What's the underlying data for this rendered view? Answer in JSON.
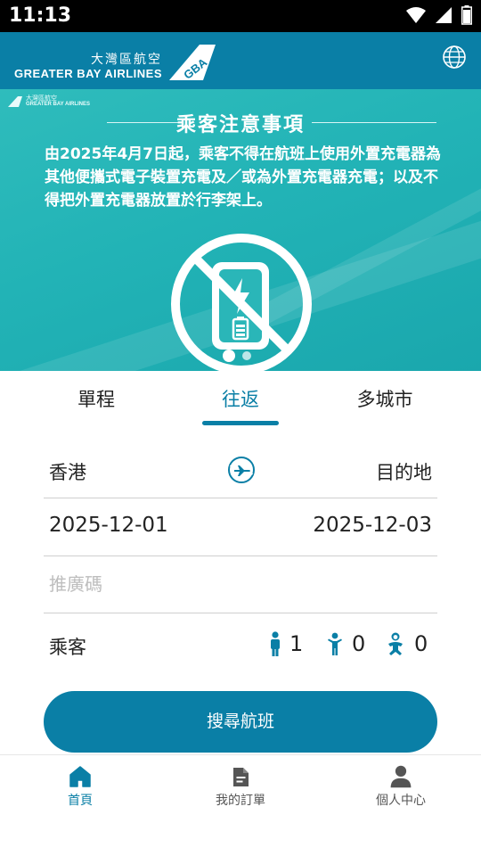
{
  "status_bar": {
    "time": "11:13"
  },
  "header": {
    "logo_cn": "大灣區航空",
    "logo_en": "GREATER BAY AIRLINES",
    "logo_tail_text": "GBA",
    "brand_color": "#0a7fa6"
  },
  "banner": {
    "mini_logo_cn": "大灣區航空",
    "mini_logo_en": "GREATER BAY AIRLINES",
    "title": "乘客注意事項",
    "notice": "由2025年4月7日起，乘客不得在航班上使用外置充電器為其他便攜式電子裝置充電及／或為外置充電器充電；以及不得把外置充電器放置於行李架上。",
    "background_color": "#22b3b6",
    "slide_count": 2,
    "active_slide": 1
  },
  "booking": {
    "tabs": [
      {
        "label": "單程"
      },
      {
        "label": "往返"
      },
      {
        "label": "多城市"
      }
    ],
    "active_tab": "往返",
    "origin": "香港",
    "destination": "目的地",
    "depart_date": "2025-12-01",
    "return_date": "2025-12-03",
    "promo_placeholder": "推廣碼",
    "promo_value": "",
    "passengers_label": "乘客",
    "adults": "1",
    "children": "0",
    "infants": "0",
    "search_label": "搜尋航班"
  },
  "bottom_nav": {
    "items": [
      {
        "label": "首頁",
        "icon": "home-icon"
      },
      {
        "label": "我的訂單",
        "icon": "document-icon"
      },
      {
        "label": "個人中心",
        "icon": "person-icon"
      }
    ],
    "active": "首頁"
  }
}
